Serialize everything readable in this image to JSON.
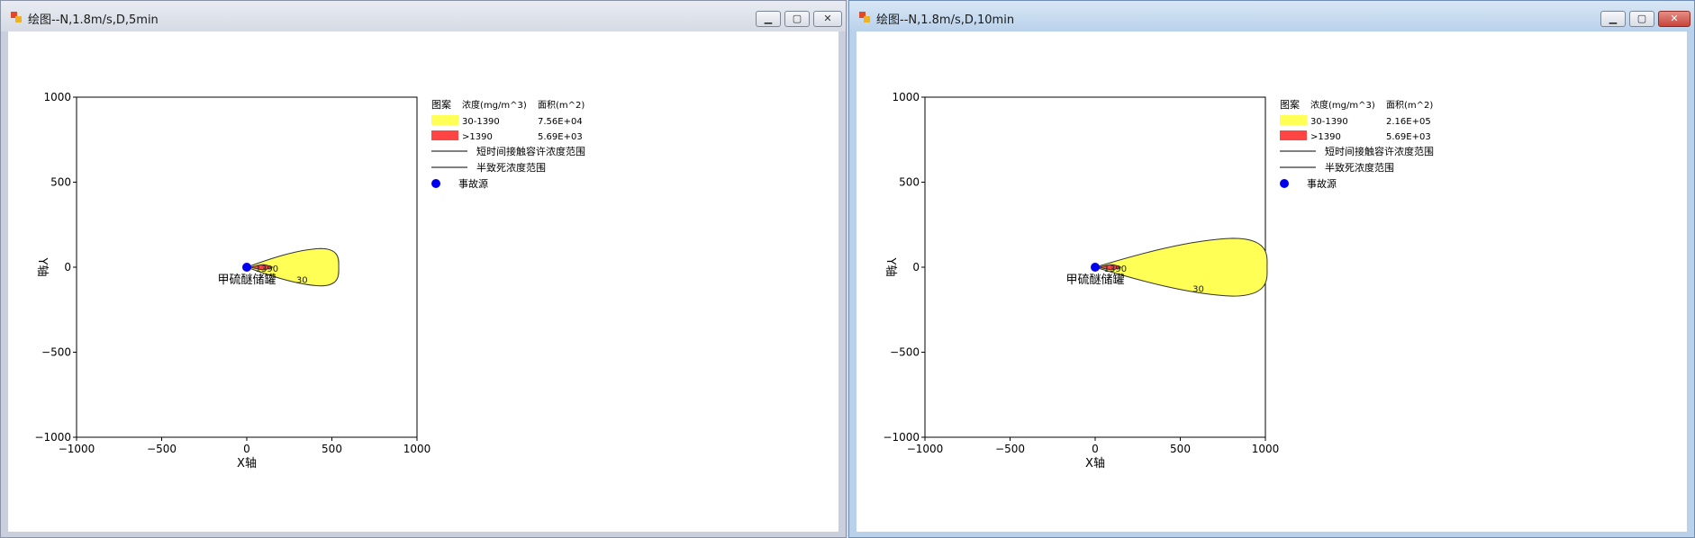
{
  "windows": [
    {
      "title": "绘图--N,1.8m/s,D,5min",
      "buttons": {
        "minimize": "▁",
        "maximize": "▢",
        "close": "✕"
      },
      "chart_data": {
        "type": "contour",
        "xlabel": "X轴",
        "ylabel": "Y轴",
        "xlim": [
          -1000,
          1000
        ],
        "ylim": [
          -1000,
          1000
        ],
        "x_ticks": [
          "−1000",
          "−500",
          "0",
          "500",
          "1000"
        ],
        "y_ticks": [
          "1000",
          "500",
          "0",
          "−500",
          "−1000"
        ],
        "source_label": "甲硫醚储罐",
        "source": [
          0,
          0
        ],
        "contour_labels": [
          "1390",
          "30"
        ],
        "plume_extent_x": 540,
        "plume_half_width": 110,
        "inner_extent_x": 150,
        "inner_half_width": 20,
        "legend": {
          "header": [
            "图案",
            "浓度(mg/m^3)",
            "面积(m^2)"
          ],
          "rows": [
            {
              "range": "30-1390",
              "area": "7.56E+04",
              "color": "#ffff55"
            },
            {
              "range": ">1390",
              "area": "5.69E+03",
              "color": "#ff4444"
            }
          ],
          "lines": [
            "短时间接触容许浓度范围",
            "半致死浓度范围"
          ],
          "source_entry": "事故源"
        }
      }
    },
    {
      "title": "绘图--N,1.8m/s,D,10min",
      "buttons": {
        "minimize": "▁",
        "maximize": "▢",
        "close": "✕"
      },
      "chart_data": {
        "type": "contour",
        "xlabel": "X轴",
        "ylabel": "Y轴",
        "xlim": [
          -1000,
          1000
        ],
        "ylim": [
          -1000,
          1000
        ],
        "x_ticks": [
          "−1000",
          "−500",
          "0",
          "500",
          "1000"
        ],
        "y_ticks": [
          "1000",
          "500",
          "0",
          "−500",
          "−1000"
        ],
        "source_label": "甲硫醚储罐",
        "source": [
          0,
          0
        ],
        "contour_labels": [
          "1390",
          "30"
        ],
        "plume_extent_x": 1010,
        "plume_half_width": 170,
        "inner_extent_x": 150,
        "inner_half_width": 20,
        "legend": {
          "header": [
            "图案",
            "浓度(mg/m^3)",
            "面积(m^2)"
          ],
          "rows": [
            {
              "range": "30-1390",
              "area": "2.16E+05",
              "color": "#ffff55"
            },
            {
              "range": ">1390",
              "area": "5.69E+03",
              "color": "#ff4444"
            }
          ],
          "lines": [
            "短时间接触容许浓度范围",
            "半致死浓度范围"
          ],
          "source_entry": "事故源"
        }
      }
    }
  ]
}
